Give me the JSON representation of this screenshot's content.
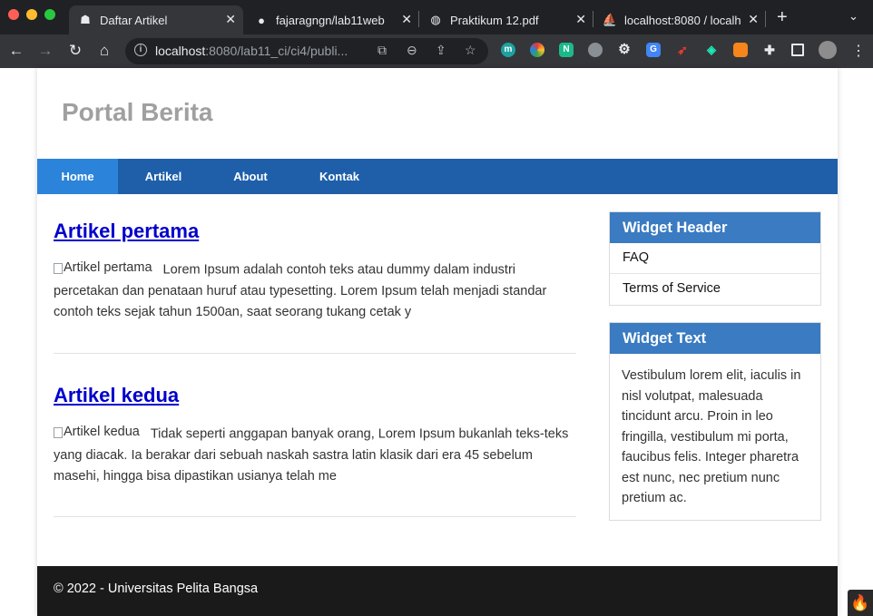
{
  "browser": {
    "tabs": [
      {
        "title": "Daftar Artikel",
        "icon": "site-icon"
      },
      {
        "title": "fajaragngn/lab11web",
        "icon": "github-icon"
      },
      {
        "title": "Praktikum 12.pdf",
        "icon": "globe-icon"
      },
      {
        "title": "localhost:8080 / localh",
        "icon": "phpmyadmin-icon"
      }
    ],
    "url_host": "localhost",
    "url_rest": ":8080/lab11_ci/ci4/publi..."
  },
  "site": {
    "title": "Portal Berita"
  },
  "nav": {
    "items": [
      "Home",
      "Artikel",
      "About",
      "Kontak"
    ],
    "active": "Home"
  },
  "articles": [
    {
      "title": "Artikel pertama",
      "img_alt": "Artikel pertama",
      "excerpt": "Lorem Ipsum adalah contoh teks atau dummy dalam industri percetakan dan penataan huruf atau typesetting. Lorem Ipsum telah menjadi standar contoh teks sejak tahun 1500an, saat seorang tukang cetak y"
    },
    {
      "title": "Artikel kedua",
      "img_alt": "Artikel kedua",
      "excerpt": "Tidak seperti anggapan banyak orang, Lorem Ipsum bukanlah teks-teks yang diacak. Ia berakar dari sebuah naskah sastra latin klasik dari era 45 sebelum masehi, hingga bisa dipastikan usianya telah me"
    }
  ],
  "widgets": {
    "links_header": "Widget Header",
    "links": [
      "FAQ",
      "Terms of Service"
    ],
    "text_header": "Widget Text",
    "text": "Vestibulum lorem elit, iaculis in nisl volutpat, malesuada tincidunt arcu. Proin in leo fringilla, vestibulum mi porta, faucibus felis. Integer pharetra est nunc, nec pretium nunc pretium ac."
  },
  "footer": {
    "text": "© 2022 - Universitas Pelita Bangsa"
  },
  "colors": {
    "nav_bg": "#1f5faa",
    "nav_active": "#2b83da",
    "widget_header": "#3a7bc2",
    "link": "#0000cc",
    "footer_bg": "#1a1a1a"
  }
}
